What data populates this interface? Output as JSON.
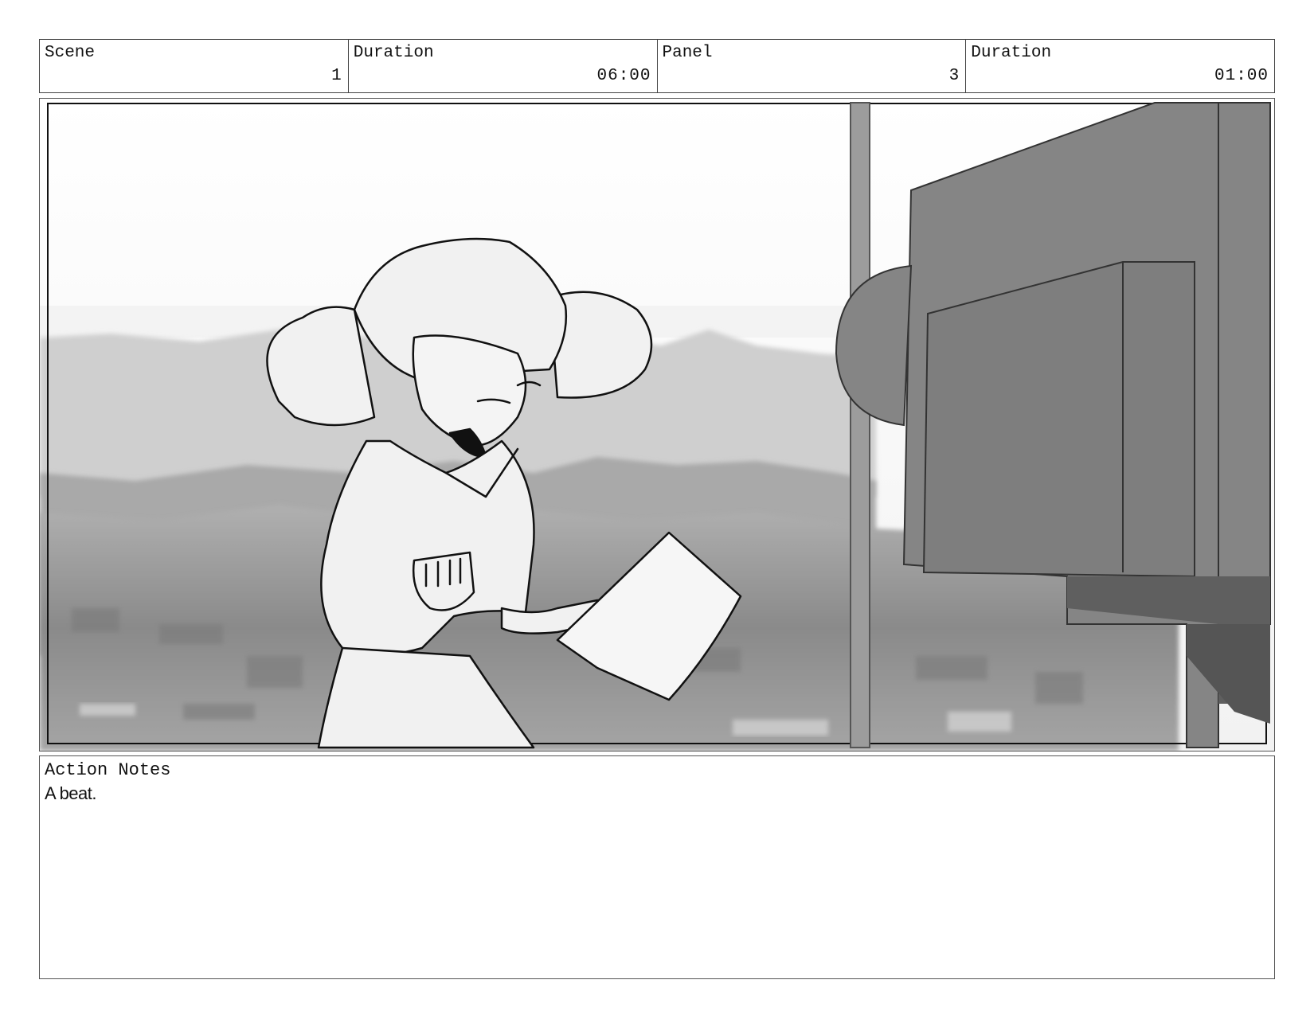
{
  "header": {
    "scene_label": "Scene",
    "scene_value": "1",
    "duration_label": "Duration",
    "duration_value": "06:00",
    "panel_label": "Panel",
    "panel_value": "3",
    "panel_duration_label": "Duration",
    "panel_duration_value": "01:00"
  },
  "notes": {
    "label": "Action Notes",
    "text": "A beat."
  }
}
